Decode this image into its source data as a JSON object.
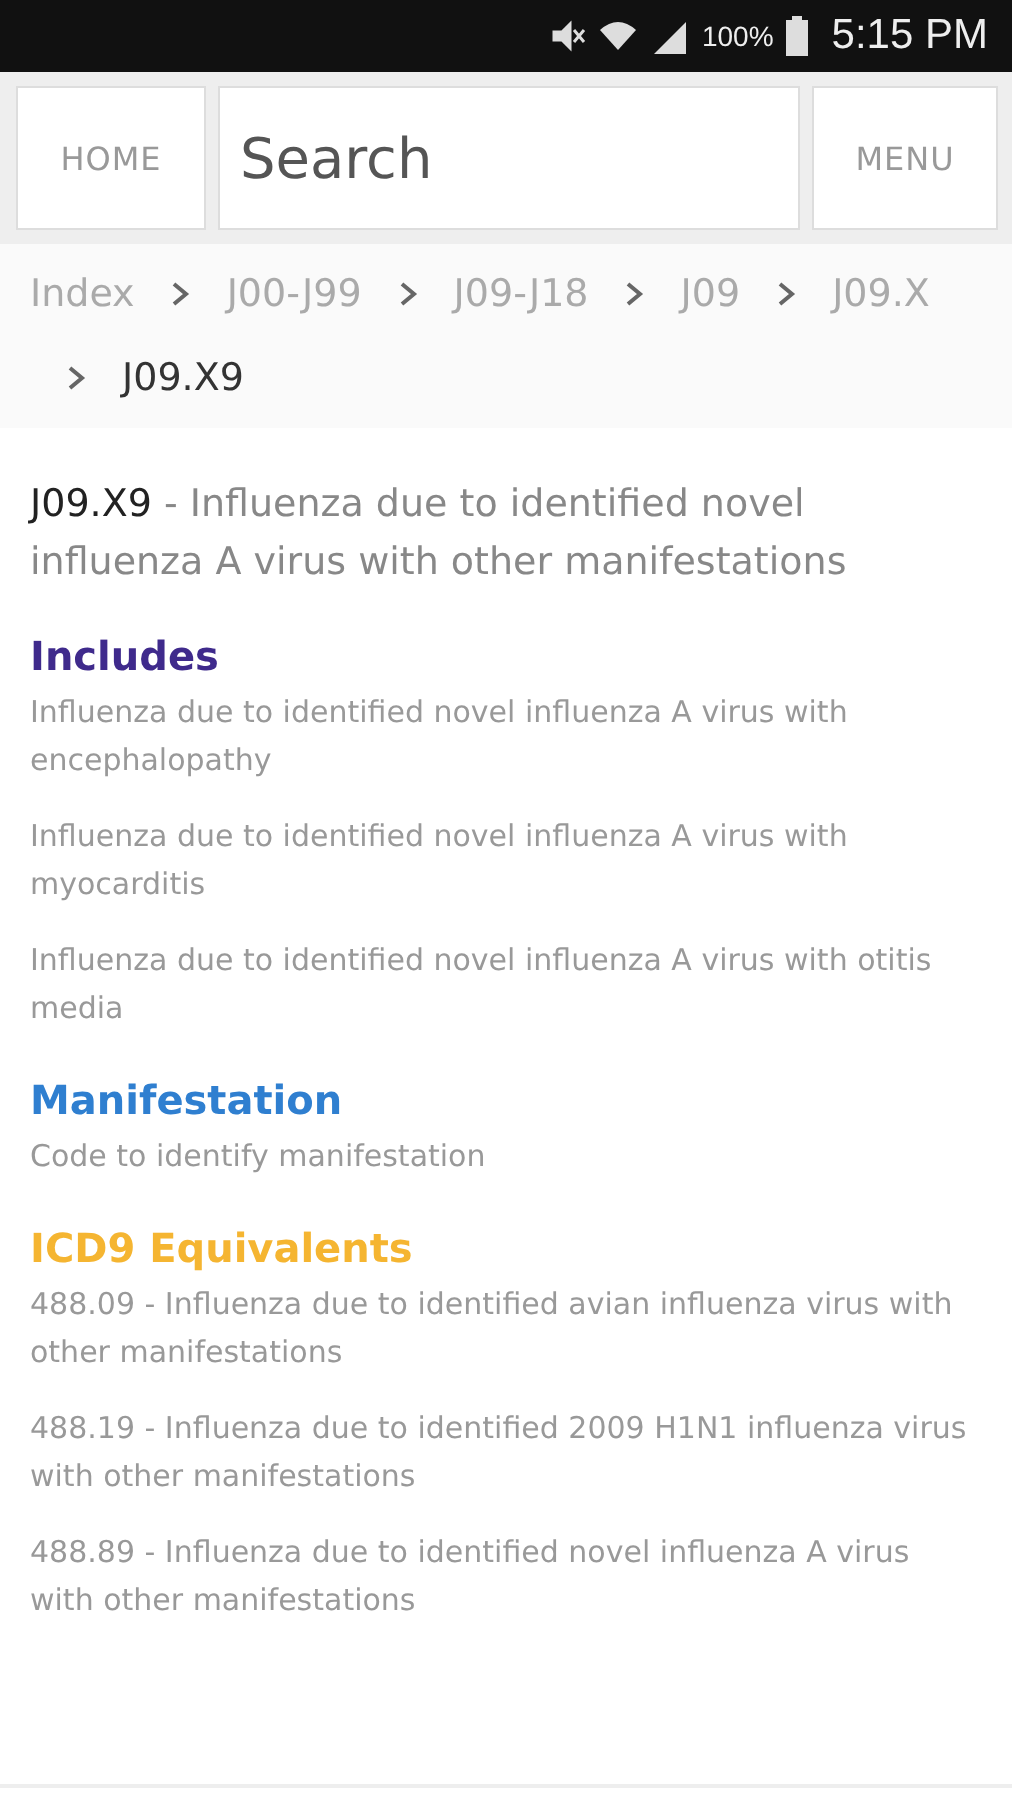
{
  "status_bar": {
    "battery": "100%",
    "time": "5:15 PM"
  },
  "header": {
    "home": "HOME",
    "search": {
      "placeholder": "Search"
    },
    "menu": "MENU"
  },
  "breadcrumb": [
    {
      "label": "Index",
      "current": false
    },
    {
      "label": "J00-J99",
      "current": false
    },
    {
      "label": "J09-J18",
      "current": false
    },
    {
      "label": "J09",
      "current": false
    },
    {
      "label": "J09.X",
      "current": false
    },
    {
      "label": "J09.X9",
      "current": true
    }
  ],
  "code": {
    "id": "J09.X9",
    "description": " - Influenza due to identified novel influenza A virus with other manifestations"
  },
  "sections": [
    {
      "heading": "Includes",
      "color": "#3f2a8c",
      "items": [
        "Influenza due to identified novel influenza A virus with encephalopathy",
        "Influenza due to identified novel influenza A virus with myocarditis",
        "Influenza due to identified novel influenza A virus with otitis media"
      ]
    },
    {
      "heading": "Manifestation",
      "color": "#2f7fd0",
      "items": [
        "Code to identify manifestation"
      ]
    },
    {
      "heading": "ICD9 Equivalents",
      "color": "#f5b531",
      "items": [
        "488.09 - Influenza due to identified avian influenza virus with other manifestations",
        "488.19 - Influenza due to identified 2009 H1N1 influenza virus with other manifestations",
        "488.89 - Influenza due to identified novel influenza A virus with other manifestations"
      ]
    }
  ]
}
